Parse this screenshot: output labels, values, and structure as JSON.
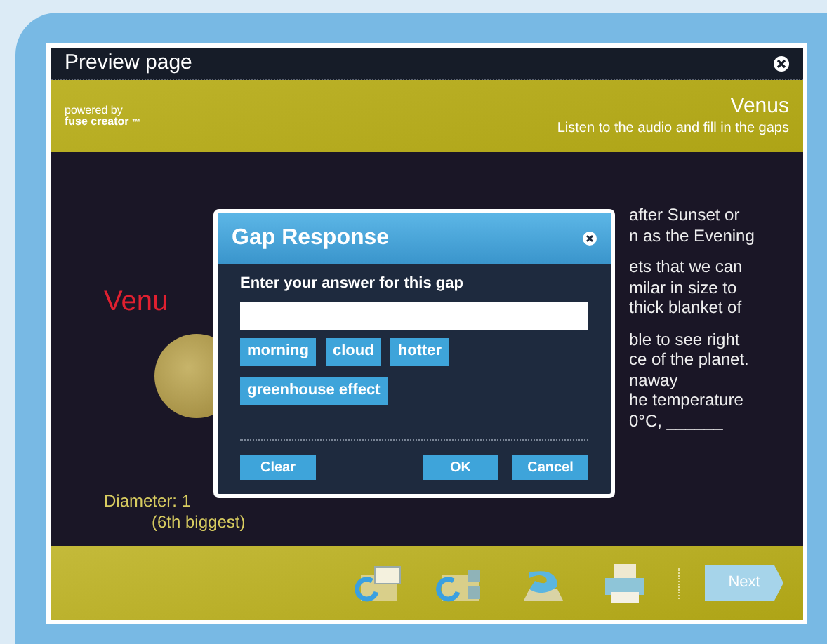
{
  "window": {
    "title": "Preview page"
  },
  "header": {
    "brand_top": "powered by",
    "brand_name": "fuse creator",
    "brand_mark": "™",
    "title": "Venus",
    "instruction": "Listen to the audio and fill in the gaps"
  },
  "content": {
    "heading": "Venu",
    "diameter": [
      "Diameter: 1",
      "(6th biggest)"
    ],
    "paragraphs": [
      [
        "after Sunset or",
        "n as the Evening"
      ],
      [
        "ets that we can",
        "milar in size to",
        "thick blanket of"
      ],
      [
        "ble to see right",
        "ce of the planet.",
        "naway",
        "he temperature",
        "0°C, ______"
      ]
    ]
  },
  "dialog": {
    "title": "Gap Response",
    "prompt": "Enter your answer for this gap",
    "options": [
      "morning",
      "cloud",
      "hotter",
      "greenhouse effect"
    ],
    "buttons": [
      "Clear",
      "OK",
      "Cancel"
    ]
  },
  "toolbar": {
    "tools": [
      {
        "kind": "replay-comment"
      },
      {
        "kind": "replay-check"
      },
      {
        "kind": "undo"
      },
      {
        "kind": "print"
      }
    ],
    "next": {
      "label": "Next",
      "disabled": true
    }
  }
}
